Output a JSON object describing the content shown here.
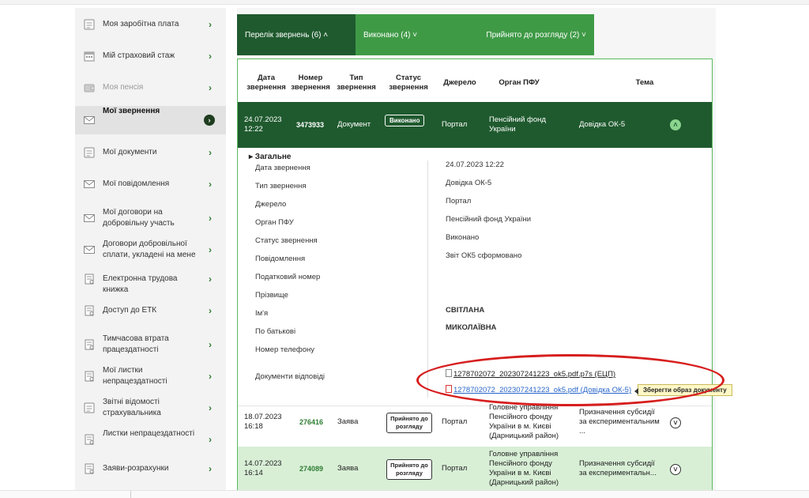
{
  "sidebar": {
    "items": [
      {
        "label": "Моя заробітна плата",
        "icon": "document-icon",
        "state": "normal"
      },
      {
        "label": "Мій страховий стаж",
        "icon": "calendar-icon",
        "state": "normal"
      },
      {
        "label": "Моя пенсія",
        "icon": "wallet-icon",
        "state": "disabled"
      },
      {
        "label": "Мої звернення",
        "icon": "envelope-icon",
        "state": "active"
      },
      {
        "label": "Мої документи",
        "icon": "document-icon",
        "state": "normal"
      },
      {
        "label": "Мої повідомлення",
        "icon": "envelope-icon",
        "state": "normal"
      },
      {
        "label": "Мої договори на добровільну участь",
        "icon": "envelope-icon",
        "state": "normal"
      },
      {
        "label": "Договори добровільної сплати, укладені на мене",
        "icon": "envelope-icon",
        "state": "normal"
      },
      {
        "label": "Електронна трудова книжка",
        "icon": "book-icon",
        "state": "normal"
      },
      {
        "label": "Доступ до ЕТК",
        "icon": "book-icon",
        "state": "normal"
      },
      {
        "label": "Тимчасова втрата працездатності",
        "icon": "book-icon",
        "state": "normal"
      },
      {
        "label": "Мої листки непрацездатності",
        "icon": "book-icon",
        "state": "normal"
      },
      {
        "label": "Звітні відомості страхувальника",
        "icon": "document-icon",
        "state": "normal"
      },
      {
        "label": "Листки непрацездатності",
        "icon": "book-icon",
        "state": "normal"
      },
      {
        "label": "Заяви-розрахунки",
        "icon": "book-icon",
        "state": "normal"
      }
    ],
    "arrow": "›"
  },
  "tabs": [
    {
      "label": "Перелік звернень (6) ˄"
    },
    {
      "label": "Виконано (4) ˅"
    },
    {
      "label": "Прийнято до розгляду (2) ˅"
    }
  ],
  "table": {
    "headers": {
      "date": "Дата звернення",
      "number": "Номер звернення",
      "type": "Тип звернення",
      "status": "Статус звернення",
      "source": "Джерело",
      "organ": "Орган ПФУ",
      "topic": "Тема"
    },
    "rows": [
      {
        "date": "24.07.2023 12:22",
        "number": "3473933",
        "type": "Документ",
        "status": "Виконано",
        "source": "Портал",
        "organ": "Пенсійний фонд України",
        "topic": "Довідка ОК-5",
        "toggle": "˄"
      },
      {
        "date": "18.07.2023 16:18",
        "number": "276416",
        "type": "Заява",
        "status": "Прийнято до розгляду",
        "source": "Портал",
        "organ": "Головне управління Пенсійного фонду України в м. Києві (Дарницький район)",
        "topic": "Призначення субсидії за експериментальним ...",
        "toggle": "˅"
      },
      {
        "date": "14.07.2023 16:14",
        "number": "274089",
        "type": "Заява",
        "status": "Прийнято до розгляду",
        "source": "Портал",
        "organ": "Головне управління Пенсійного фонду України в м. Києві (Дарницький район)",
        "topic": "Призначення субсидії за експериментальн...",
        "toggle": "˅"
      }
    ]
  },
  "details": {
    "title": "▸ Загальне",
    "fields": [
      {
        "label": "Дата звернення",
        "value": "24.07.2023 12:22"
      },
      {
        "label": "Тип звернення",
        "value": "Довідка ОК-5"
      },
      {
        "label": "Джерело",
        "value": "Портал"
      },
      {
        "label": "Орган ПФУ",
        "value": "Пенсійний фонд України"
      },
      {
        "label": "Статус звернення",
        "value": "Виконано"
      },
      {
        "label": "Повідомлення",
        "value": "Звіт ОК5 сформовано"
      },
      {
        "label": "Податковий номер",
        "value": ""
      },
      {
        "label": "Прізвище",
        "value": ""
      },
      {
        "label": "Ім'я",
        "value": "СВІТЛАНА"
      },
      {
        "label": "По батькові",
        "value": "МИКОЛАЇВНА"
      },
      {
        "label": "Номер телефону",
        "value": ""
      },
      {
        "label": "Документи відповіді",
        "value": ""
      }
    ],
    "documents": [
      {
        "label": "1278702072_202307241223_ok5.pdf.p7s (ЕЦП)"
      },
      {
        "label": "1278702072_202307241223_ok5.pdf (Довідка ОК-5)"
      }
    ],
    "tooltip": "Зберегти образ документу"
  },
  "colors": {
    "dark_green": "#1f5a2e",
    "green": "#3f9a46",
    "light_green": "#d8efd6",
    "annotation_red": "#d71e1e"
  }
}
